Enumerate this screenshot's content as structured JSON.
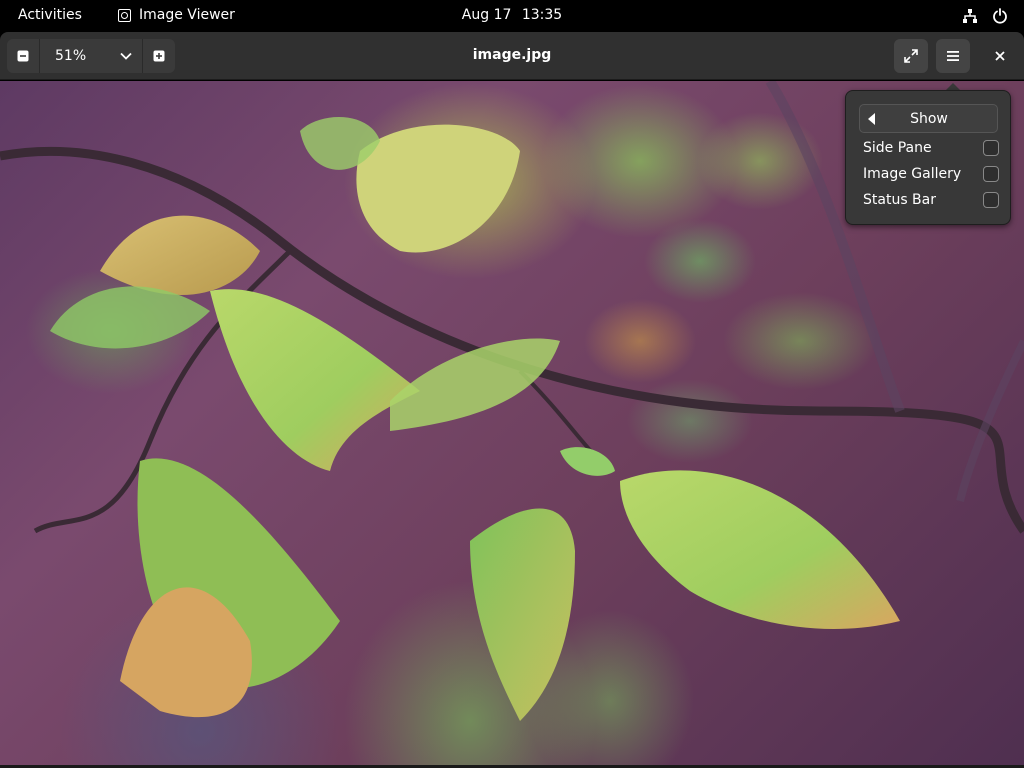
{
  "topbar": {
    "activities": "Activities",
    "app_name": "Image Viewer",
    "date": "Aug 17",
    "time": "13:35",
    "icons": [
      "network-icon",
      "power-icon"
    ]
  },
  "header": {
    "zoom_value": "51%",
    "title": "image.jpg",
    "buttons": [
      "zoom-out-button",
      "zoom-in-button",
      "fullscreen-button",
      "main-menu-button",
      "close-button"
    ]
  },
  "menu": {
    "header": "Show",
    "items": [
      {
        "label": "Side Pane",
        "checked": false
      },
      {
        "label": "Image Gallery",
        "checked": false
      },
      {
        "label": "Status Bar",
        "checked": false
      }
    ]
  },
  "colors": {
    "topbar_bg": "#000000",
    "headerbar_bg": "#303030",
    "popover_bg": "#383838"
  }
}
